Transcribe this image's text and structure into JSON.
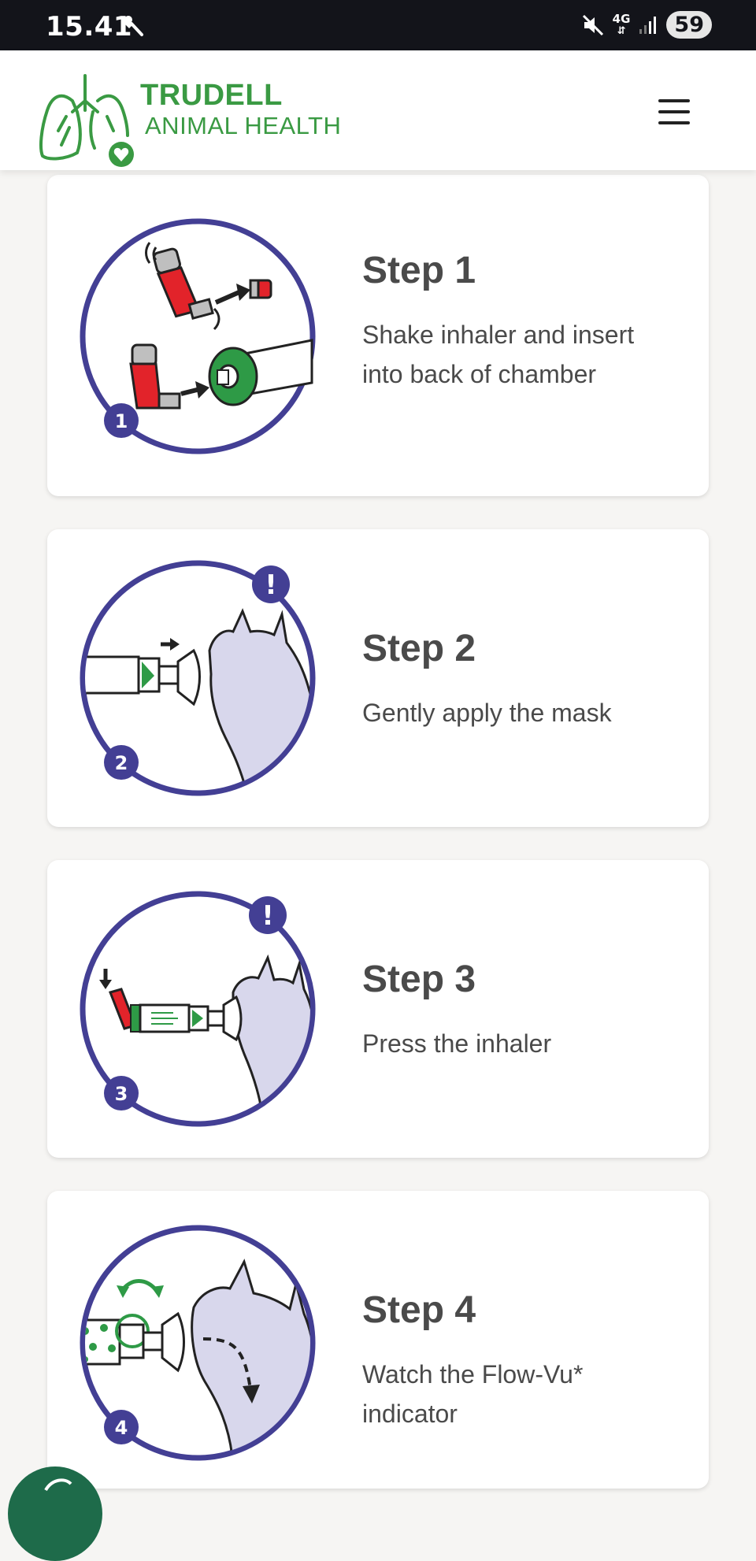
{
  "status_bar": {
    "time": "15.41",
    "network": "4G",
    "battery": "59",
    "icons": [
      "tool-icon",
      "mute-icon",
      "network-icon",
      "signal-icon",
      "battery-icon"
    ]
  },
  "header": {
    "brand_title": "TRUDELL",
    "brand_subtitle": "ANIMAL HEALTH",
    "brand_color": "#3a9a43",
    "menu_icon": "hamburger-icon"
  },
  "steps": [
    {
      "title": "Step 1",
      "description": "Shake inhaler and insert into back of chamber",
      "badge": "1",
      "alert": false
    },
    {
      "title": "Step 2",
      "description": "Gently apply the mask",
      "badge": "2",
      "alert": true
    },
    {
      "title": "Step 3",
      "description": "Press the inhaler",
      "badge": "3",
      "alert": true
    },
    {
      "title": "Step 4",
      "description": "Watch the Flow-Vu* indicator",
      "badge": "4",
      "alert": false
    }
  ],
  "colors": {
    "circle": "#433f94",
    "cat_fill": "#d8d7ec",
    "inhaler_red": "#e2232a",
    "chamber_green": "#2e9a46"
  }
}
